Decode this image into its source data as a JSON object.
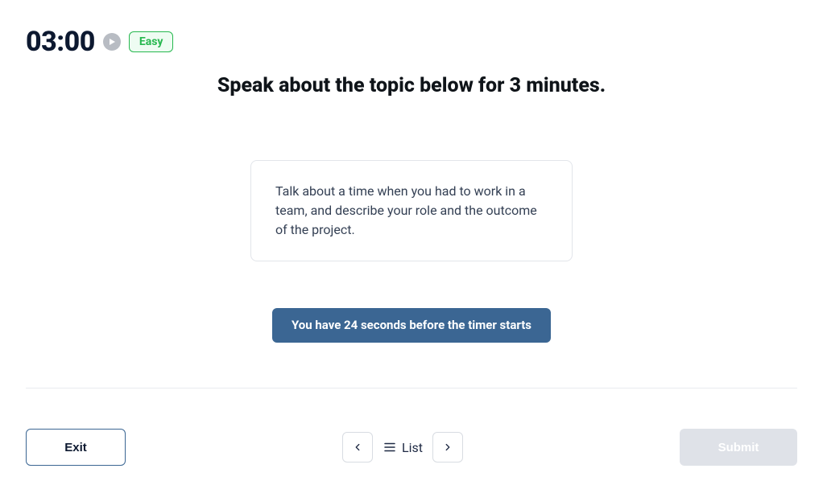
{
  "header": {
    "timer": "03:00",
    "difficulty": "Easy"
  },
  "instruction": "Speak about the topic below for 3 minutes.",
  "topic": "Talk about a time when you had to work in a team, and describe your role and the outcome of the project.",
  "countdown": "You have 24 seconds before the timer starts",
  "footer": {
    "exit": "Exit",
    "list": "List",
    "submit": "Submit"
  }
}
